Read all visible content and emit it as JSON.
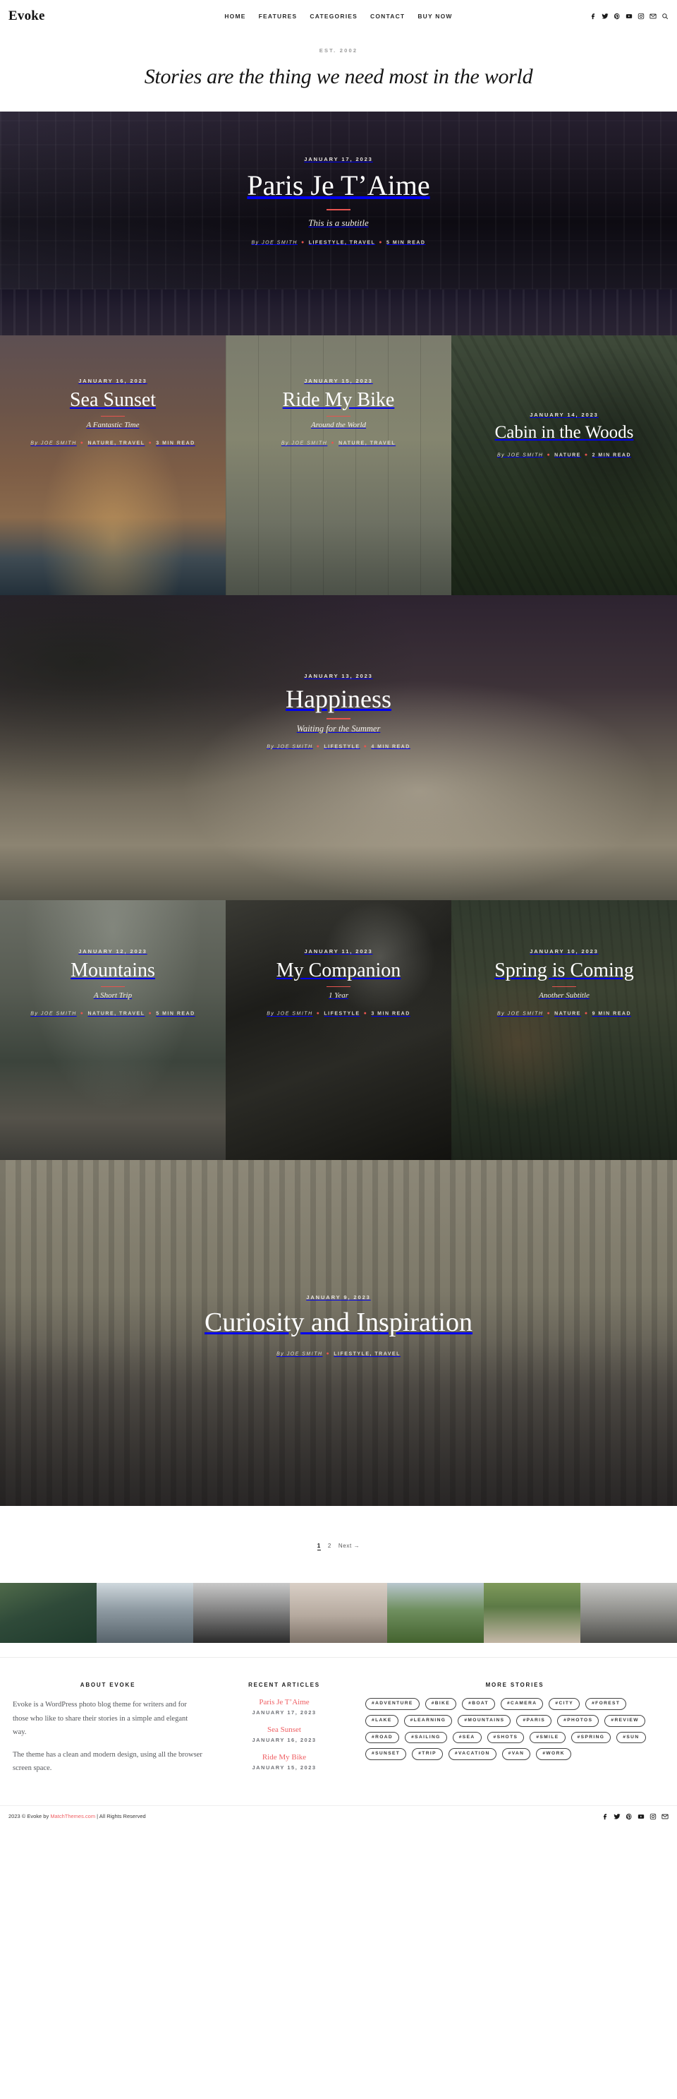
{
  "header": {
    "brand": "Evoke",
    "nav": [
      {
        "label": "HOME"
      },
      {
        "label": "FEATURES"
      },
      {
        "label": "CATEGORIES"
      },
      {
        "label": "CONTACT"
      },
      {
        "label": "BUY NOW"
      }
    ],
    "social": [
      "facebook-icon",
      "twitter-icon",
      "pinterest-icon",
      "youtube-icon",
      "instagram-icon",
      "email-icon"
    ],
    "search_icon": "search-icon"
  },
  "intro": {
    "est": "EST. 2002",
    "headline": "Stories are the thing we need most in the world"
  },
  "accent_color": "#e8544f",
  "link_color": "#ef5f63",
  "posts": [
    {
      "title": "Paris Je T’Aime",
      "date": "JANUARY 17, 2023",
      "subtitle": "This is a subtitle",
      "author": "By JOE SMITH",
      "categories": "LIFESTYLE, TRAVEL",
      "readtime": "5 MIN READ"
    },
    {
      "title": "Sea Sunset",
      "date": "JANUARY 16, 2023",
      "subtitle": "A Fantastic Time",
      "author": "By JOE SMITH",
      "categories": "NATURE, TRAVEL",
      "readtime": "3 MIN READ"
    },
    {
      "title": "Ride My Bike",
      "date": "JANUARY 15, 2023",
      "subtitle": "Around the World",
      "author": "By JOE SMITH",
      "categories": "NATURE, TRAVEL",
      "readtime": ""
    },
    {
      "title": "Cabin in the Woods",
      "date": "JANUARY 14, 2023",
      "subtitle": "",
      "author": "By JOE SMITH",
      "categories": "NATURE",
      "readtime": "2 MIN READ"
    },
    {
      "title": "Happiness",
      "date": "JANUARY 13, 2023",
      "subtitle": "Waiting for the Summer",
      "author": "By JOE SMITH",
      "categories": "LIFESTYLE",
      "readtime": "4 MIN READ"
    },
    {
      "title": "Mountains",
      "date": "JANUARY 12, 2023",
      "subtitle": "A Short Trip",
      "author": "By JOE SMITH",
      "categories": "NATURE, TRAVEL",
      "readtime": "5 MIN READ"
    },
    {
      "title": "My Companion",
      "date": "JANUARY 11, 2023",
      "subtitle": "1 Year",
      "author": "By JOE SMITH",
      "categories": "LIFESTYLE",
      "readtime": "3 MIN READ"
    },
    {
      "title": "Spring is Coming",
      "date": "JANUARY 10, 2023",
      "subtitle": "Another Subtitle",
      "author": "By JOE SMITH",
      "categories": "NATURE",
      "readtime": "9 MIN READ"
    },
    {
      "title": "Curiosity and Inspiration",
      "date": "JANUARY 9, 2023",
      "subtitle": "",
      "author": "By JOE SMITH",
      "categories": "LIFESTYLE, TRAVEL",
      "readtime": ""
    }
  ],
  "pagination": {
    "current": "1",
    "page2": "2",
    "next": "Next →"
  },
  "footer": {
    "about": {
      "title": "ABOUT EVOKE",
      "p1": "Evoke is a WordPress photo blog theme for writers and for those who like to share their stories in a simple and elegant way.",
      "p2": "The theme has a clean and modern design, using all the browser screen space."
    },
    "recent": {
      "title": "RECENT ARTICLES",
      "items": [
        {
          "title": "Paris Je T’Aime",
          "date": "JANUARY 17, 2023"
        },
        {
          "title": "Sea Sunset",
          "date": "JANUARY 16, 2023"
        },
        {
          "title": "Ride My Bike",
          "date": "JANUARY 15, 2023"
        }
      ]
    },
    "tags": {
      "title": "MORE STORIES",
      "items": [
        "#ADVENTURE",
        "#BIKE",
        "#BOAT",
        "#CAMERA",
        "#CITY",
        "#FOREST",
        "#LAKE",
        "#LEARNING",
        "#MOUNTAINS",
        "#PARIS",
        "#PHOTOS",
        "#REVIEW",
        "#ROAD",
        "#SAILING",
        "#SEA",
        "#SHOTS",
        "#SMILE",
        "#SPRING",
        "#SUN",
        "#SUNSET",
        "#TRIP",
        "#VACATION",
        "#VAN",
        "#WORK"
      ]
    },
    "copyright_pre": "2023 © Evoke by ",
    "copyright_link": "MatchThemes.com",
    "copyright_post": " | All Rights Reserved",
    "social": [
      "facebook-icon",
      "twitter-icon",
      "pinterest-icon",
      "youtube-icon",
      "instagram-icon",
      "email-icon"
    ]
  }
}
